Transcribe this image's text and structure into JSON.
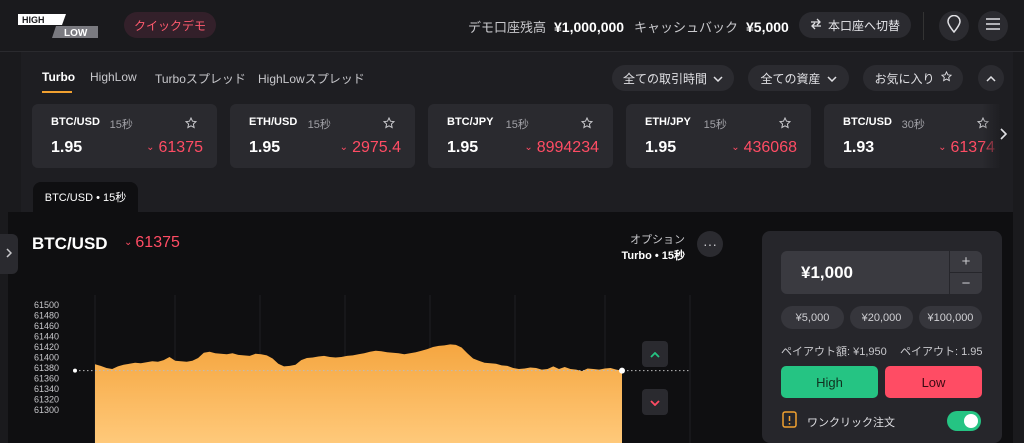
{
  "header": {
    "logo_top": "HIGH",
    "logo_bottom": "LOW",
    "demo_label": "クイックデモ",
    "balance_label": "デモ口座残高",
    "balance_value": "¥1,000,000",
    "cashback_label": "キャッシュバック",
    "cashback_value": "¥5,000",
    "switch_label": "本口座へ切替"
  },
  "tabs": [
    "Turbo",
    "HighLow",
    "Turboスプレッド",
    "HighLowスプレッド"
  ],
  "filters": {
    "time": "全ての取引時間",
    "assets": "全ての資産",
    "favorites": "お気に入り"
  },
  "cards": [
    {
      "pair": "BTC/USD",
      "duration": "15秒",
      "payout": "1.95",
      "price": "61375"
    },
    {
      "pair": "ETH/USD",
      "duration": "15秒",
      "payout": "1.95",
      "price": "2975.4"
    },
    {
      "pair": "BTC/JPY",
      "duration": "15秒",
      "payout": "1.95",
      "price": "8994234"
    },
    {
      "pair": "ETH/JPY",
      "duration": "15秒",
      "payout": "1.95",
      "price": "436068"
    },
    {
      "pair": "BTC/USD",
      "duration": "30秒",
      "payout": "1.93",
      "price": "61374"
    }
  ],
  "active_chip": "BTC/USD • 15秒",
  "chart_header": {
    "asset": "BTC/USD",
    "price": "61375",
    "option_label": "オプション",
    "option_value": "Turbo • 15秒",
    "more": "···"
  },
  "chart_data": {
    "type": "area",
    "y_ticks": [
      "61500",
      "61480",
      "61460",
      "61440",
      "61420",
      "61400",
      "61380",
      "61360",
      "61340",
      "61320",
      "61300"
    ],
    "ylim": [
      61300,
      61500
    ],
    "values": [
      61387,
      61384,
      61380,
      61378,
      61383,
      61386,
      61388,
      61390,
      61389,
      61391,
      61393,
      61392,
      61395,
      61401,
      61394,
      61393,
      61392,
      61394,
      61399,
      61409,
      61411,
      61408,
      61407,
      61406,
      61408,
      61405,
      61404,
      61403,
      61407,
      61406,
      61404,
      61398,
      61388,
      61383,
      61384,
      61386,
      61395,
      61399,
      61400,
      61402,
      61403,
      61401,
      61400,
      61401,
      61403,
      61404,
      61406,
      61408,
      61411,
      61413,
      61412,
      61410,
      61409,
      61408,
      61406,
      61408,
      61410,
      61413,
      61416,
      61420,
      61422,
      61423,
      61425,
      61424,
      61419,
      61408,
      61398,
      61394,
      61390,
      61389,
      61388,
      61385,
      61384,
      61380,
      61378,
      61379,
      61381,
      61380,
      61377,
      61378,
      61383,
      61378,
      61382,
      61378,
      61377,
      61374,
      61379,
      61378,
      61377,
      61379,
      61380,
      61377,
      61375
    ],
    "current_value": 61375
  },
  "trade": {
    "amount": "¥1,000",
    "plus": "+",
    "minus": "−",
    "quick_amounts": [
      "¥5,000",
      "¥20,000",
      "¥100,000"
    ],
    "payout_amount_label": "ペイアウト額: ¥1,950",
    "payout_rate_label": "ペイアウト: 1.95",
    "high": "High",
    "low": "Low",
    "one_click": "ワンクリック注文"
  },
  "colors": {
    "accent": "#f0a030",
    "high": "#25c483",
    "low": "#ff4c64",
    "area": "#f7b256"
  },
  "icons": [
    "switch-arrows-icon",
    "location-pin-icon",
    "menu-icon",
    "chevron-down-icon",
    "star-icon",
    "chevron-up-icon",
    "chevron-right-icon",
    "up-arrow-icon",
    "down-arrow-icon",
    "info-icon"
  ]
}
